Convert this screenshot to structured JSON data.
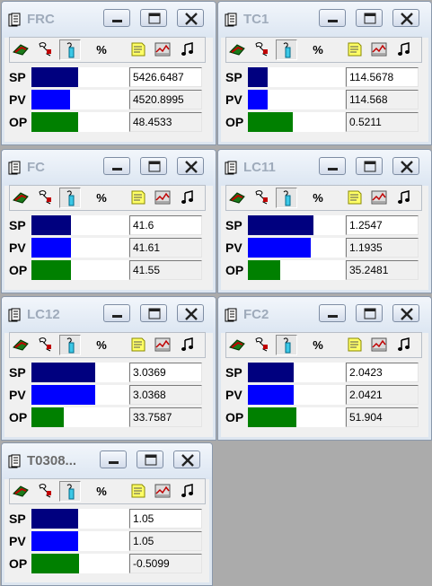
{
  "panels": [
    {
      "title": "FRC",
      "title_color": "#9fabbb",
      "rows": [
        {
          "label": "SP",
          "value": "5426.6487",
          "bar_fraction": 0.48,
          "bar_color": "#00007f"
        },
        {
          "label": "PV",
          "value": "4520.8995",
          "bar_fraction": 0.4,
          "bar_color": "#0000ff"
        },
        {
          "label": "OP",
          "value": "48.4533",
          "bar_fraction": 0.48,
          "bar_color": "#008000"
        }
      ]
    },
    {
      "title": "TC1",
      "title_color": "#9fabbb",
      "rows": [
        {
          "label": "SP",
          "value": "114.5678",
          "bar_fraction": 0.2,
          "bar_color": "#00007f"
        },
        {
          "label": "PV",
          "value": "114.568",
          "bar_fraction": 0.2,
          "bar_color": "#0000ff"
        },
        {
          "label": "OP",
          "value": "0.5211",
          "bar_fraction": 0.46,
          "bar_color": "#008000"
        }
      ]
    },
    {
      "title": "FC",
      "title_color": "#9fabbb",
      "rows": [
        {
          "label": "SP",
          "value": "41.6",
          "bar_fraction": 0.41,
          "bar_color": "#00007f"
        },
        {
          "label": "PV",
          "value": "41.61",
          "bar_fraction": 0.41,
          "bar_color": "#0000ff"
        },
        {
          "label": "OP",
          "value": "41.55",
          "bar_fraction": 0.41,
          "bar_color": "#008000"
        }
      ]
    },
    {
      "title": "LC11",
      "title_color": "#9fabbb",
      "rows": [
        {
          "label": "SP",
          "value": "1.2547",
          "bar_fraction": 0.68,
          "bar_color": "#00007f"
        },
        {
          "label": "PV",
          "value": "1.1935",
          "bar_fraction": 0.65,
          "bar_color": "#0000ff"
        },
        {
          "label": "OP",
          "value": "35.2481",
          "bar_fraction": 0.33,
          "bar_color": "#008000"
        }
      ]
    },
    {
      "title": "LC12",
      "title_color": "#9fabbb",
      "rows": [
        {
          "label": "SP",
          "value": "3.0369",
          "bar_fraction": 0.66,
          "bar_color": "#00007f"
        },
        {
          "label": "PV",
          "value": "3.0368",
          "bar_fraction": 0.66,
          "bar_color": "#0000ff"
        },
        {
          "label": "OP",
          "value": "33.7587",
          "bar_fraction": 0.33,
          "bar_color": "#008000"
        }
      ]
    },
    {
      "title": "FC2",
      "title_color": "#9fabbb",
      "rows": [
        {
          "label": "SP",
          "value": "2.0423",
          "bar_fraction": 0.47,
          "bar_color": "#00007f"
        },
        {
          "label": "PV",
          "value": "2.0421",
          "bar_fraction": 0.47,
          "bar_color": "#0000ff"
        },
        {
          "label": "OP",
          "value": "51.904",
          "bar_fraction": 0.5,
          "bar_color": "#008000"
        }
      ]
    },
    {
      "title": "T0308...",
      "title_color": "#6b6b6b",
      "rows": [
        {
          "label": "SP",
          "value": "1.05",
          "bar_fraction": 0.48,
          "bar_color": "#00007f"
        },
        {
          "label": "PV",
          "value": "1.05",
          "bar_fraction": 0.48,
          "bar_color": "#0000ff"
        },
        {
          "label": "OP",
          "value": "-0.5099",
          "bar_fraction": 0.49,
          "bar_color": "#008000"
        }
      ]
    }
  ],
  "toolbar": {
    "percent_label": "%",
    "tools": [
      "faceplate-icon",
      "tuning-icon",
      "trend-pen-icon",
      "percent",
      "notes-icon",
      "trend-chart-icon",
      "alarm-sound-icon"
    ]
  }
}
